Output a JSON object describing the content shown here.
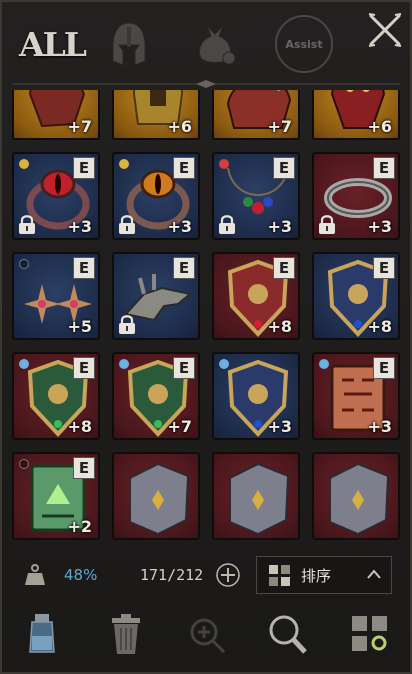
{
  "tabs": {
    "all_label": "ALL",
    "helmet_icon": "helmet-icon",
    "bag_icon": "loot-bag-icon",
    "assist_label": "Assist"
  },
  "slots": [
    {
      "id": "r0c0",
      "bg": "gold",
      "item": "gauntlet",
      "plus": "+7",
      "badge": "",
      "lock": false,
      "dot": ""
    },
    {
      "id": "r0c1",
      "bg": "gold",
      "item": "helmet-gold",
      "plus": "+6",
      "badge": "",
      "lock": false,
      "dot": ""
    },
    {
      "id": "r0c2",
      "bg": "gold",
      "item": "shoulder-armor",
      "plus": "+7",
      "badge": "",
      "lock": false,
      "dot": ""
    },
    {
      "id": "r0c3",
      "bg": "gold",
      "item": "mask",
      "plus": "+6",
      "badge": "",
      "lock": false,
      "dot": ""
    },
    {
      "id": "r1c0",
      "bg": "blue",
      "item": "red-eye-ring",
      "plus": "+3",
      "badge": "E",
      "lock": true,
      "dot": "#d8b440"
    },
    {
      "id": "r1c1",
      "bg": "blue",
      "item": "orange-eye-ring",
      "plus": "+3",
      "badge": "E",
      "lock": true,
      "dot": "#d8b440"
    },
    {
      "id": "r1c2",
      "bg": "blue",
      "item": "gem-necklace",
      "plus": "+3",
      "badge": "E",
      "lock": true,
      "dot": "#d04040"
    },
    {
      "id": "r1c3",
      "bg": "red",
      "item": "silver-ring",
      "plus": "+3",
      "badge": "E",
      "lock": true,
      "dot": ""
    },
    {
      "id": "r2c0",
      "bg": "blue",
      "item": "star-earrings",
      "plus": "+5",
      "badge": "E",
      "lock": false,
      "dot": "empty"
    },
    {
      "id": "r2c1",
      "bg": "blue",
      "item": "dragon-head",
      "plus": "",
      "badge": "E",
      "lock": true,
      "dot": ""
    },
    {
      "id": "r2c2",
      "bg": "red",
      "item": "crest-red",
      "plus": "+8",
      "badge": "E",
      "lock": false,
      "dot": ""
    },
    {
      "id": "r2c3",
      "bg": "blue",
      "item": "crest-blue",
      "plus": "+8",
      "badge": "E",
      "lock": false,
      "dot": ""
    },
    {
      "id": "r3c0",
      "bg": "red",
      "item": "crest-green",
      "plus": "+8",
      "badge": "E",
      "lock": false,
      "dot": "#6ab0e0"
    },
    {
      "id": "r3c1",
      "bg": "red",
      "item": "crest-green",
      "plus": "+7",
      "badge": "E",
      "lock": false,
      "dot": "#6ab0e0"
    },
    {
      "id": "r3c2",
      "bg": "blue",
      "item": "crest-blue",
      "plus": "+3",
      "badge": "",
      "lock": false,
      "dot": "#6ab0e0"
    },
    {
      "id": "r3c3",
      "bg": "red",
      "item": "rune-book-red",
      "plus": "+3",
      "badge": "E",
      "lock": false,
      "dot": "#6ab0e0"
    },
    {
      "id": "r4c0",
      "bg": "red",
      "item": "rune-book-green",
      "plus": "+2",
      "badge": "E",
      "lock": false,
      "dot": "empty"
    },
    {
      "id": "r4c1",
      "bg": "red",
      "item": "stone-tablet",
      "plus": "",
      "badge": "",
      "lock": false,
      "dot": ""
    },
    {
      "id": "r4c2",
      "bg": "red",
      "item": "stone-tablet",
      "plus": "",
      "badge": "",
      "lock": false,
      "dot": ""
    },
    {
      "id": "r4c3",
      "bg": "red",
      "item": "stone-tablet",
      "plus": "",
      "badge": "",
      "lock": false,
      "dot": ""
    }
  ],
  "status": {
    "weight_percent": "48%",
    "capacity": "171/212",
    "sort_label": "排序"
  },
  "footer": [
    "potion-icon",
    "trash-can-icon",
    "zoom-in-icon",
    "search-icon",
    "grid-filter-icon"
  ],
  "colors": {
    "accent_blue": "#5fa8d6",
    "badge_bg": "#e9e5dc"
  }
}
